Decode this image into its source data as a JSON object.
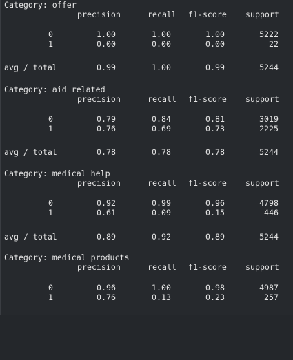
{
  "headers": {
    "precision": "precision",
    "recall": "recall",
    "f1": "f1-score",
    "support": "support"
  },
  "blocks": [
    {
      "title": "Category: offer",
      "rows": [
        {
          "label": "0",
          "precision": "1.00",
          "recall": "1.00",
          "f1": "1.00",
          "support": "5222"
        },
        {
          "label": "1",
          "precision": "0.00",
          "recall": "0.00",
          "f1": "0.00",
          "support": "22"
        }
      ],
      "avg": {
        "label": "avg / total",
        "precision": "0.99",
        "recall": "1.00",
        "f1": "0.99",
        "support": "5244"
      }
    },
    {
      "title": "Category: aid_related",
      "rows": [
        {
          "label": "0",
          "precision": "0.79",
          "recall": "0.84",
          "f1": "0.81",
          "support": "3019"
        },
        {
          "label": "1",
          "precision": "0.76",
          "recall": "0.69",
          "f1": "0.73",
          "support": "2225"
        }
      ],
      "avg": {
        "label": "avg / total",
        "precision": "0.78",
        "recall": "0.78",
        "f1": "0.78",
        "support": "5244"
      }
    },
    {
      "title": "Category: medical_help",
      "rows": [
        {
          "label": "0",
          "precision": "0.92",
          "recall": "0.99",
          "f1": "0.96",
          "support": "4798"
        },
        {
          "label": "1",
          "precision": "0.61",
          "recall": "0.09",
          "f1": "0.15",
          "support": "446"
        }
      ],
      "avg": {
        "label": "avg / total",
        "precision": "0.89",
        "recall": "0.92",
        "f1": "0.89",
        "support": "5244"
      }
    },
    {
      "title": "Category: medical_products",
      "rows": [
        {
          "label": "0",
          "precision": "0.96",
          "recall": "1.00",
          "f1": "0.98",
          "support": "4987"
        },
        {
          "label": "1",
          "precision": "0.76",
          "recall": "0.13",
          "f1": "0.23",
          "support": "257"
        }
      ]
    }
  ]
}
